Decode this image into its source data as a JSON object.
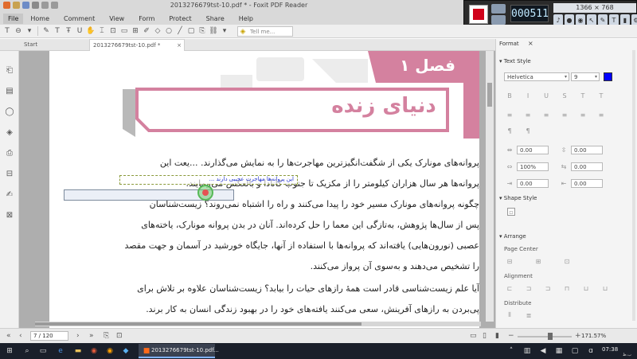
{
  "window": {
    "title": "2013276679tst-10.pdf * - Foxit PDF Reader"
  },
  "recorder": {
    "timer": "000511",
    "resolution": "1366 × 768"
  },
  "menu": {
    "file": "File",
    "items": [
      "Home",
      "Comment",
      "View",
      "Form",
      "Protect",
      "Share",
      "Help"
    ],
    "tell_me": "Tell me..."
  },
  "tabs": {
    "start": "Start",
    "doc": "2013276679tst-10.pdf *"
  },
  "document": {
    "chapter_label": "فصل ۱",
    "chapter_title": "دنیای زنده",
    "paragraph1": [
      "پروانه‌های مونارک یکی از شگفت‌انگیزترین مهاجرت‌ها را به نمایش می‌گذارند. ...یعت این",
      "پروانه‌ها هر سال هزاران کیلومتر را از مکزیک تا جنوب کانادا و بالعکس می‌پیمایند.",
      "چگونه پروانه‌های مونارک مسیر خود را پیدا می‌کنند و راه را اشتباه نمی‌روند؟ زیست‌شناسان",
      "پس از سال‌ها پژوهش، به‌تازگی این معما را حل کرده‌اند. آنان در بدن پروانه مونارک، یاخته‌های",
      "عصبی (نورون‌هایی) یافته‌اند که پروانه‌ها با استفاده از آنها، جایگاه خورشید در آسمان و جهت مقصد",
      "را تشخیص می‌دهند و به‌سوی آن پرواز می‌کنند."
    ],
    "paragraph2": [
      "آیا علم زیست‌شناسی قادر است همهٔ رازهای حیات را بیابد؟ زیست‌شناسان علاوه بر تلاش برای",
      "پی‌بردن به رازهای آفرینش، سعی می‌کنند یافته‌های خود را در بهبود زندگی انسان به کار برند."
    ],
    "annotation_text": "این پروانه‌ها مهاجرت عجیبی دارند ..."
  },
  "format_panel": {
    "tab_label": "Format",
    "text_style_header": "Text Style",
    "font_name": "Helvetica",
    "font_size": "9",
    "spacing_1": "0.00",
    "spacing_2": "0.00",
    "scale_1": "100%",
    "scale_2": "0.00",
    "offset_1": "0.00",
    "offset_2": "0.00",
    "shape_style_header": "Shape Style",
    "arrange_header": "Arrange",
    "page_center_label": "Page Center",
    "alignment_label": "Alignment",
    "distribute_label": "Distribute",
    "text_color": "#0000ff"
  },
  "status": {
    "page": "7 / 120",
    "zoom": "171.57%"
  },
  "taskbar": {
    "active_label": "2013276679tst-10.pdf...",
    "clock": "07:38",
    "date": "ب.ظ"
  },
  "colors": {
    "accent_pink": "#d4819f",
    "record_red": "#d0021b"
  }
}
